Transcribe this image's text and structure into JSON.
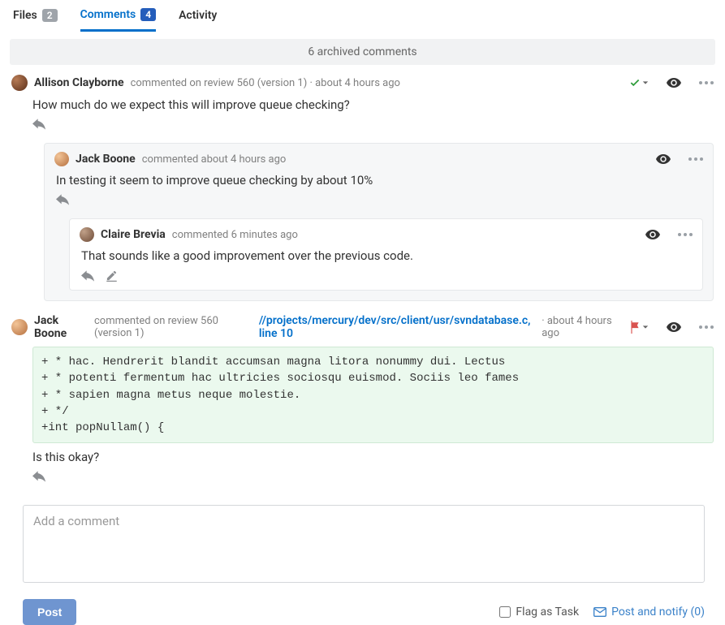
{
  "tabs": {
    "files": {
      "label": "Files",
      "count": "2"
    },
    "comments": {
      "label": "Comments",
      "count": "4"
    },
    "activity": {
      "label": "Activity"
    }
  },
  "archived_banner": "6 archived comments",
  "comment1": {
    "author": "Allison Clayborne",
    "meta": "commented on review 560 (version 1) · about 4 hours ago",
    "body": "How much do we expect this will improve queue checking?"
  },
  "reply1": {
    "author": "Jack Boone",
    "meta": "commented about 4 hours ago",
    "body": "In testing it seem to improve queue checking by about 10%"
  },
  "reply2": {
    "author": "Claire Brevia",
    "meta": "commented 6 minutes ago",
    "body": "That sounds like a good improvement over the previous code."
  },
  "comment2": {
    "author": "Jack Boone",
    "meta_prefix": "commented on review 560 (version 1)",
    "file_link": "//projects/mercury/dev/src/client/usr/svndatabase.c, line 10",
    "meta_suffix": "· about 4 hours ago",
    "code": "+ * hac. Hendrerit blandit accumsan magna litora nonummy dui. Lectus\n+ * potenti fermentum hac ultricies sociosqu euismod. Sociis leo fames\n+ * sapien magna metus neque molestie.\n+ */\n+int popNullam() {",
    "body": "Is this okay?"
  },
  "composer": {
    "placeholder": "Add a comment"
  },
  "footer": {
    "post": "Post",
    "flag_task": "Flag as Task",
    "notify": "Post and notify (0)"
  }
}
